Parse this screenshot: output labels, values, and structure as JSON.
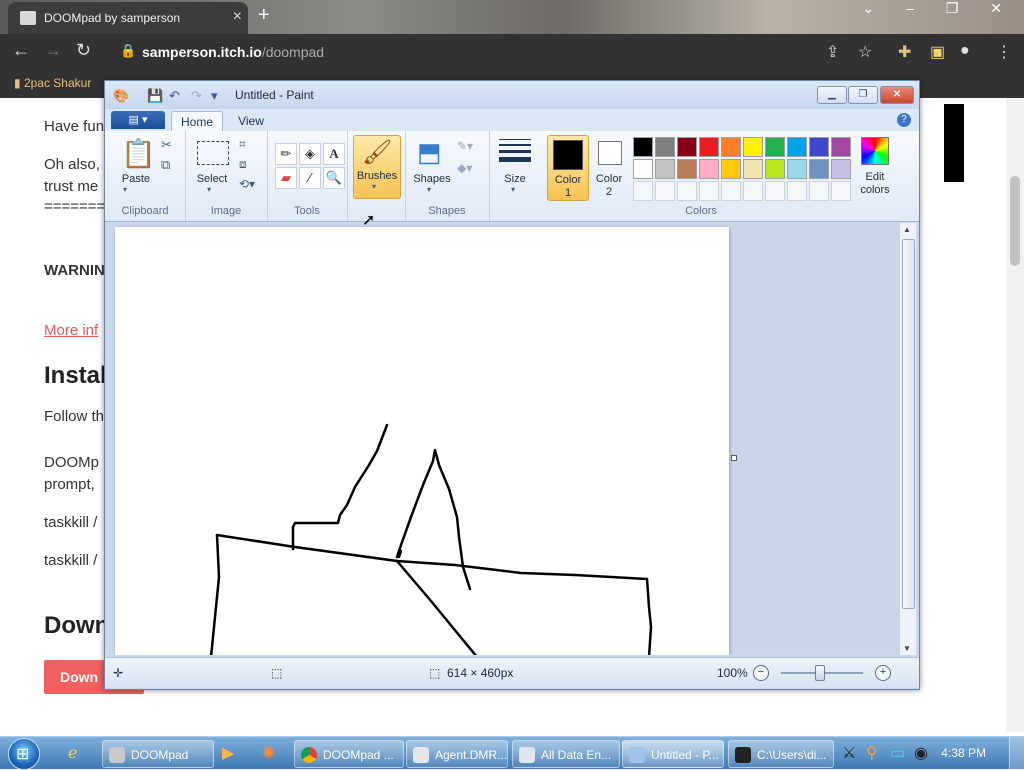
{
  "browser": {
    "tab_title": "DOOMpad by samperson",
    "new_tab": "+",
    "url_domain": "samperson.itch.io",
    "url_path": "/doompad",
    "bookmark": "2pac Shakur"
  },
  "page": {
    "line1": "Have fun",
    "line2": "Oh also,",
    "line3": "trust me",
    "line4": "========",
    "warning": "WARNIN",
    "more_info": "More inf",
    "install_heading": "Instal",
    "follow": "Follow th",
    "doomp": "DOOMp",
    "prompt": "prompt,",
    "taskkill1": "taskkill /",
    "taskkill2": "taskkill /",
    "download_heading": "Down",
    "download_button": "Down"
  },
  "paint": {
    "window_title": "Untitled - Paint",
    "file_menu": "▾",
    "tabs": [
      "Home",
      "View"
    ],
    "buttons": {
      "paste": "Paste",
      "select": "Select",
      "brushes": "Brushes",
      "shapes": "Shapes",
      "size": "Size",
      "color1": "Color\n1",
      "color1_l1": "Color",
      "color1_l2": "1",
      "color2_l1": "Color",
      "color2_l2": "2",
      "edit_colors_l1": "Edit",
      "edit_colors_l2": "colors"
    },
    "groups": {
      "clipboard": "Clipboard",
      "image": "Image",
      "tools": "Tools",
      "shapes": "Shapes",
      "colors": "Colors"
    },
    "palette_row1": [
      "#000000",
      "#7f7f7f",
      "#880015",
      "#ed1c24",
      "#ff7f27",
      "#fff200",
      "#22b14c",
      "#00a2e8",
      "#3f48cc",
      "#a349a4"
    ],
    "palette_row2": [
      "#ffffff",
      "#c3c3c3",
      "#b97a57",
      "#ffaec9",
      "#ffc90e",
      "#efe4b0",
      "#b5e61d",
      "#99d9ea",
      "#7092be",
      "#c8bfe7"
    ],
    "color1_value": "#000000",
    "color2_value": "#ffffff",
    "status": {
      "dimensions": "614 × 460px",
      "zoom": "100%"
    }
  },
  "taskbar": {
    "items": [
      "DOOMpad",
      "DOOMpad ...",
      "Agent.DMR...",
      "All Data En...",
      "Untitled - P...",
      "C:\\Users\\di..."
    ],
    "clock": "4:38 PM"
  }
}
